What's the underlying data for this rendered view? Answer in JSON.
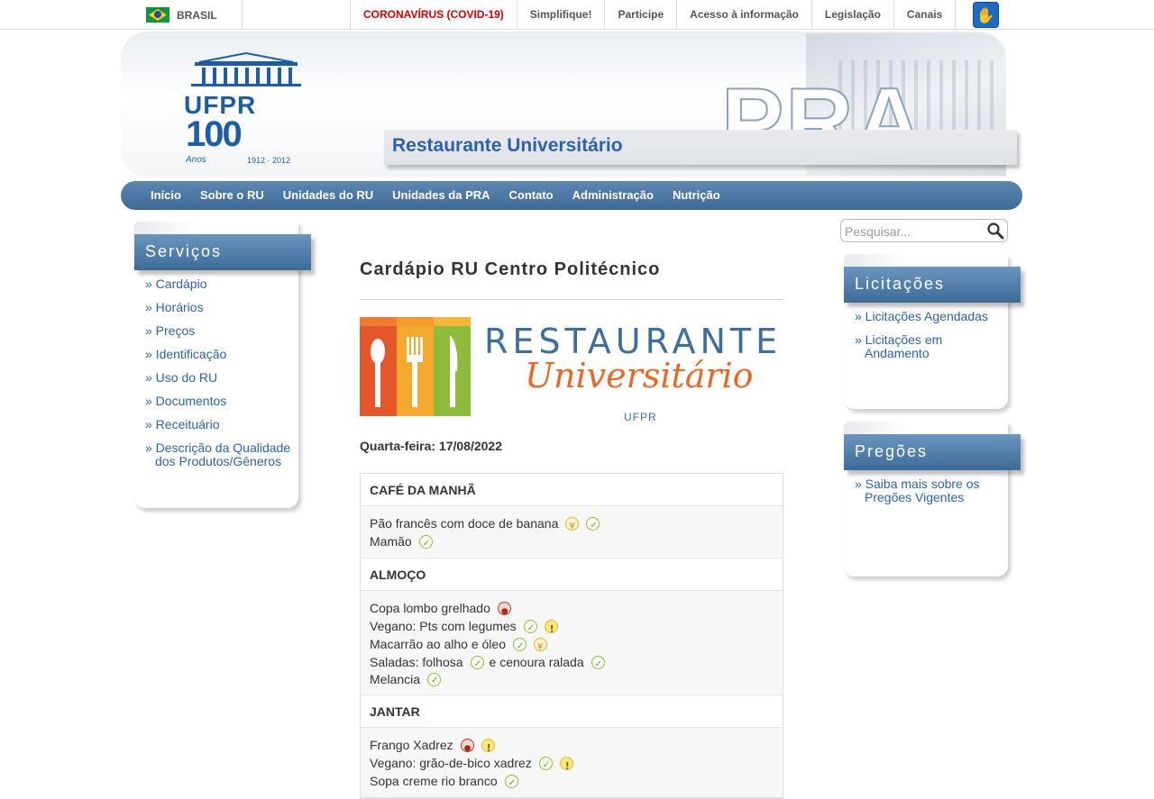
{
  "gov": {
    "country": "BRASIL",
    "links": [
      "CORONAVÍRUS (COVID-19)",
      "Simplifique!",
      "Participe",
      "Acesso à informação",
      "Legislação",
      "Canais"
    ],
    "accessibility_icon": "hand-sign-icon"
  },
  "header": {
    "logo_text": "UFPR",
    "logo_number": "100",
    "logo_anos": "Anos",
    "logo_years": "1912 · 2012",
    "brand": "PRA",
    "site_title": "Restaurante Universitário"
  },
  "nav": [
    "Início",
    "Sobre o RU",
    "Unidades do RU",
    "Unidades da PRA",
    "Contato",
    "Administração",
    "Nutrição"
  ],
  "search": {
    "placeholder": "Pesquisar..."
  },
  "sidebar": {
    "title": "Serviços",
    "items": [
      "» Cardápio",
      "» Horários",
      "» Preços",
      "» Identificação",
      "» Uso do RU",
      "» Documentos",
      "» Receituário",
      "» Descrição da Qualidade dos Produtos/Gêneros"
    ]
  },
  "licitacoes": {
    "title": "Licitações",
    "items": [
      "» Licitações Agendadas",
      "» Licitações em Andamento"
    ]
  },
  "pregoes": {
    "title": "Pregões",
    "items": [
      "» Saiba mais sobre os Pregões Vigentes"
    ]
  },
  "main": {
    "page_title": "Cardápio RU Centro Politécnico",
    "banner": {
      "word1": "RESTAURANTE",
      "word2": "Universitário",
      "sub": "UFPR"
    },
    "date_line": "Quarta-feira: 17/08/2022",
    "sections": [
      {
        "title": "CAFÉ DA MANHÃ",
        "items": [
          {
            "text": "Pão francês com doce de banana",
            "icons": [
              "gluten-icon",
              "vegan-icon"
            ]
          },
          {
            "text": "Mamão",
            "icons": [
              "vegan-icon"
            ]
          }
        ]
      },
      {
        "title": "ALMOÇO",
        "items": [
          {
            "text": "Copa lombo grelhado",
            "icons": [
              "meat-icon"
            ]
          },
          {
            "text": "Vegano: Pts com legumes",
            "icons": [
              "vegan-icon",
              "allergen-icon"
            ]
          },
          {
            "text": "Macarrão ao alho e óleo",
            "icons": [
              "vegan-icon",
              "gluten-icon"
            ]
          },
          {
            "text": "Saladas: folhosa",
            "icons": [
              "vegan-icon"
            ],
            "text2": "e cenoura ralada",
            "icons2": [
              "vegan-icon"
            ]
          },
          {
            "text": "Melancia",
            "icons": [
              "vegan-icon"
            ]
          }
        ]
      },
      {
        "title": "JANTAR",
        "items": [
          {
            "text": "Frango Xadrez",
            "icons": [
              "meat-icon",
              "allergen-icon"
            ]
          },
          {
            "text": "Vegano: grão-de-bico xadrez",
            "icons": [
              "vegan-icon",
              "allergen-icon"
            ]
          },
          {
            "text": "Sopa creme rio branco",
            "icons": [
              "vegan-icon"
            ]
          }
        ]
      }
    ]
  },
  "colors": {
    "nav_blue": "#3d6a98",
    "link_blue": "#2e62a8",
    "covid_red": "#d00000",
    "banner_orange": "#e56a2a"
  }
}
